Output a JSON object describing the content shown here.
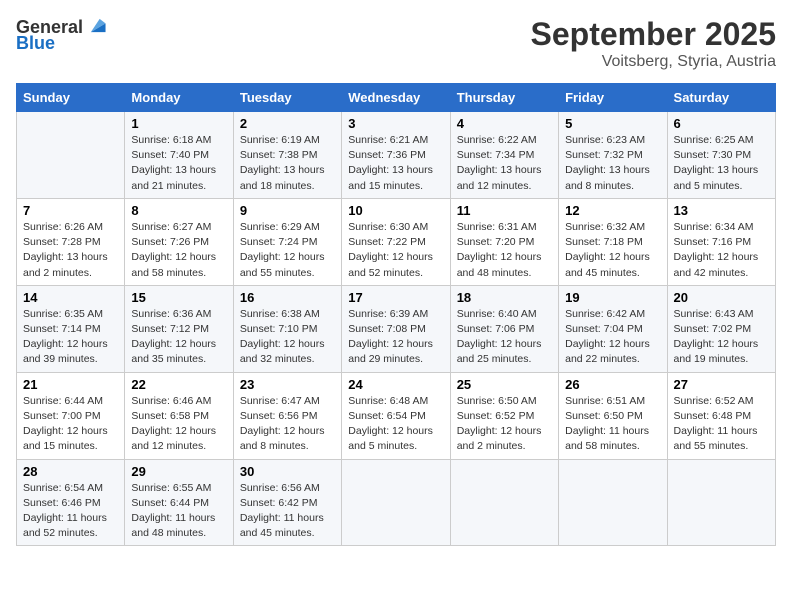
{
  "header": {
    "logo": {
      "general": "General",
      "blue": "Blue"
    },
    "title": "September 2025",
    "location": "Voitsberg, Styria, Austria"
  },
  "columns": [
    "Sunday",
    "Monday",
    "Tuesday",
    "Wednesday",
    "Thursday",
    "Friday",
    "Saturday"
  ],
  "weeks": [
    [
      {
        "day": "",
        "info": ""
      },
      {
        "day": "1",
        "info": "Sunrise: 6:18 AM\nSunset: 7:40 PM\nDaylight: 13 hours\nand 21 minutes."
      },
      {
        "day": "2",
        "info": "Sunrise: 6:19 AM\nSunset: 7:38 PM\nDaylight: 13 hours\nand 18 minutes."
      },
      {
        "day": "3",
        "info": "Sunrise: 6:21 AM\nSunset: 7:36 PM\nDaylight: 13 hours\nand 15 minutes."
      },
      {
        "day": "4",
        "info": "Sunrise: 6:22 AM\nSunset: 7:34 PM\nDaylight: 13 hours\nand 12 minutes."
      },
      {
        "day": "5",
        "info": "Sunrise: 6:23 AM\nSunset: 7:32 PM\nDaylight: 13 hours\nand 8 minutes."
      },
      {
        "day": "6",
        "info": "Sunrise: 6:25 AM\nSunset: 7:30 PM\nDaylight: 13 hours\nand 5 minutes."
      }
    ],
    [
      {
        "day": "7",
        "info": "Sunrise: 6:26 AM\nSunset: 7:28 PM\nDaylight: 13 hours\nand 2 minutes."
      },
      {
        "day": "8",
        "info": "Sunrise: 6:27 AM\nSunset: 7:26 PM\nDaylight: 12 hours\nand 58 minutes."
      },
      {
        "day": "9",
        "info": "Sunrise: 6:29 AM\nSunset: 7:24 PM\nDaylight: 12 hours\nand 55 minutes."
      },
      {
        "day": "10",
        "info": "Sunrise: 6:30 AM\nSunset: 7:22 PM\nDaylight: 12 hours\nand 52 minutes."
      },
      {
        "day": "11",
        "info": "Sunrise: 6:31 AM\nSunset: 7:20 PM\nDaylight: 12 hours\nand 48 minutes."
      },
      {
        "day": "12",
        "info": "Sunrise: 6:32 AM\nSunset: 7:18 PM\nDaylight: 12 hours\nand 45 minutes."
      },
      {
        "day": "13",
        "info": "Sunrise: 6:34 AM\nSunset: 7:16 PM\nDaylight: 12 hours\nand 42 minutes."
      }
    ],
    [
      {
        "day": "14",
        "info": "Sunrise: 6:35 AM\nSunset: 7:14 PM\nDaylight: 12 hours\nand 39 minutes."
      },
      {
        "day": "15",
        "info": "Sunrise: 6:36 AM\nSunset: 7:12 PM\nDaylight: 12 hours\nand 35 minutes."
      },
      {
        "day": "16",
        "info": "Sunrise: 6:38 AM\nSunset: 7:10 PM\nDaylight: 12 hours\nand 32 minutes."
      },
      {
        "day": "17",
        "info": "Sunrise: 6:39 AM\nSunset: 7:08 PM\nDaylight: 12 hours\nand 29 minutes."
      },
      {
        "day": "18",
        "info": "Sunrise: 6:40 AM\nSunset: 7:06 PM\nDaylight: 12 hours\nand 25 minutes."
      },
      {
        "day": "19",
        "info": "Sunrise: 6:42 AM\nSunset: 7:04 PM\nDaylight: 12 hours\nand 22 minutes."
      },
      {
        "day": "20",
        "info": "Sunrise: 6:43 AM\nSunset: 7:02 PM\nDaylight: 12 hours\nand 19 minutes."
      }
    ],
    [
      {
        "day": "21",
        "info": "Sunrise: 6:44 AM\nSunset: 7:00 PM\nDaylight: 12 hours\nand 15 minutes."
      },
      {
        "day": "22",
        "info": "Sunrise: 6:46 AM\nSunset: 6:58 PM\nDaylight: 12 hours\nand 12 minutes."
      },
      {
        "day": "23",
        "info": "Sunrise: 6:47 AM\nSunset: 6:56 PM\nDaylight: 12 hours\nand 8 minutes."
      },
      {
        "day": "24",
        "info": "Sunrise: 6:48 AM\nSunset: 6:54 PM\nDaylight: 12 hours\nand 5 minutes."
      },
      {
        "day": "25",
        "info": "Sunrise: 6:50 AM\nSunset: 6:52 PM\nDaylight: 12 hours\nand 2 minutes."
      },
      {
        "day": "26",
        "info": "Sunrise: 6:51 AM\nSunset: 6:50 PM\nDaylight: 11 hours\nand 58 minutes."
      },
      {
        "day": "27",
        "info": "Sunrise: 6:52 AM\nSunset: 6:48 PM\nDaylight: 11 hours\nand 55 minutes."
      }
    ],
    [
      {
        "day": "28",
        "info": "Sunrise: 6:54 AM\nSunset: 6:46 PM\nDaylight: 11 hours\nand 52 minutes."
      },
      {
        "day": "29",
        "info": "Sunrise: 6:55 AM\nSunset: 6:44 PM\nDaylight: 11 hours\nand 48 minutes."
      },
      {
        "day": "30",
        "info": "Sunrise: 6:56 AM\nSunset: 6:42 PM\nDaylight: 11 hours\nand 45 minutes."
      },
      {
        "day": "",
        "info": ""
      },
      {
        "day": "",
        "info": ""
      },
      {
        "day": "",
        "info": ""
      },
      {
        "day": "",
        "info": ""
      }
    ]
  ]
}
